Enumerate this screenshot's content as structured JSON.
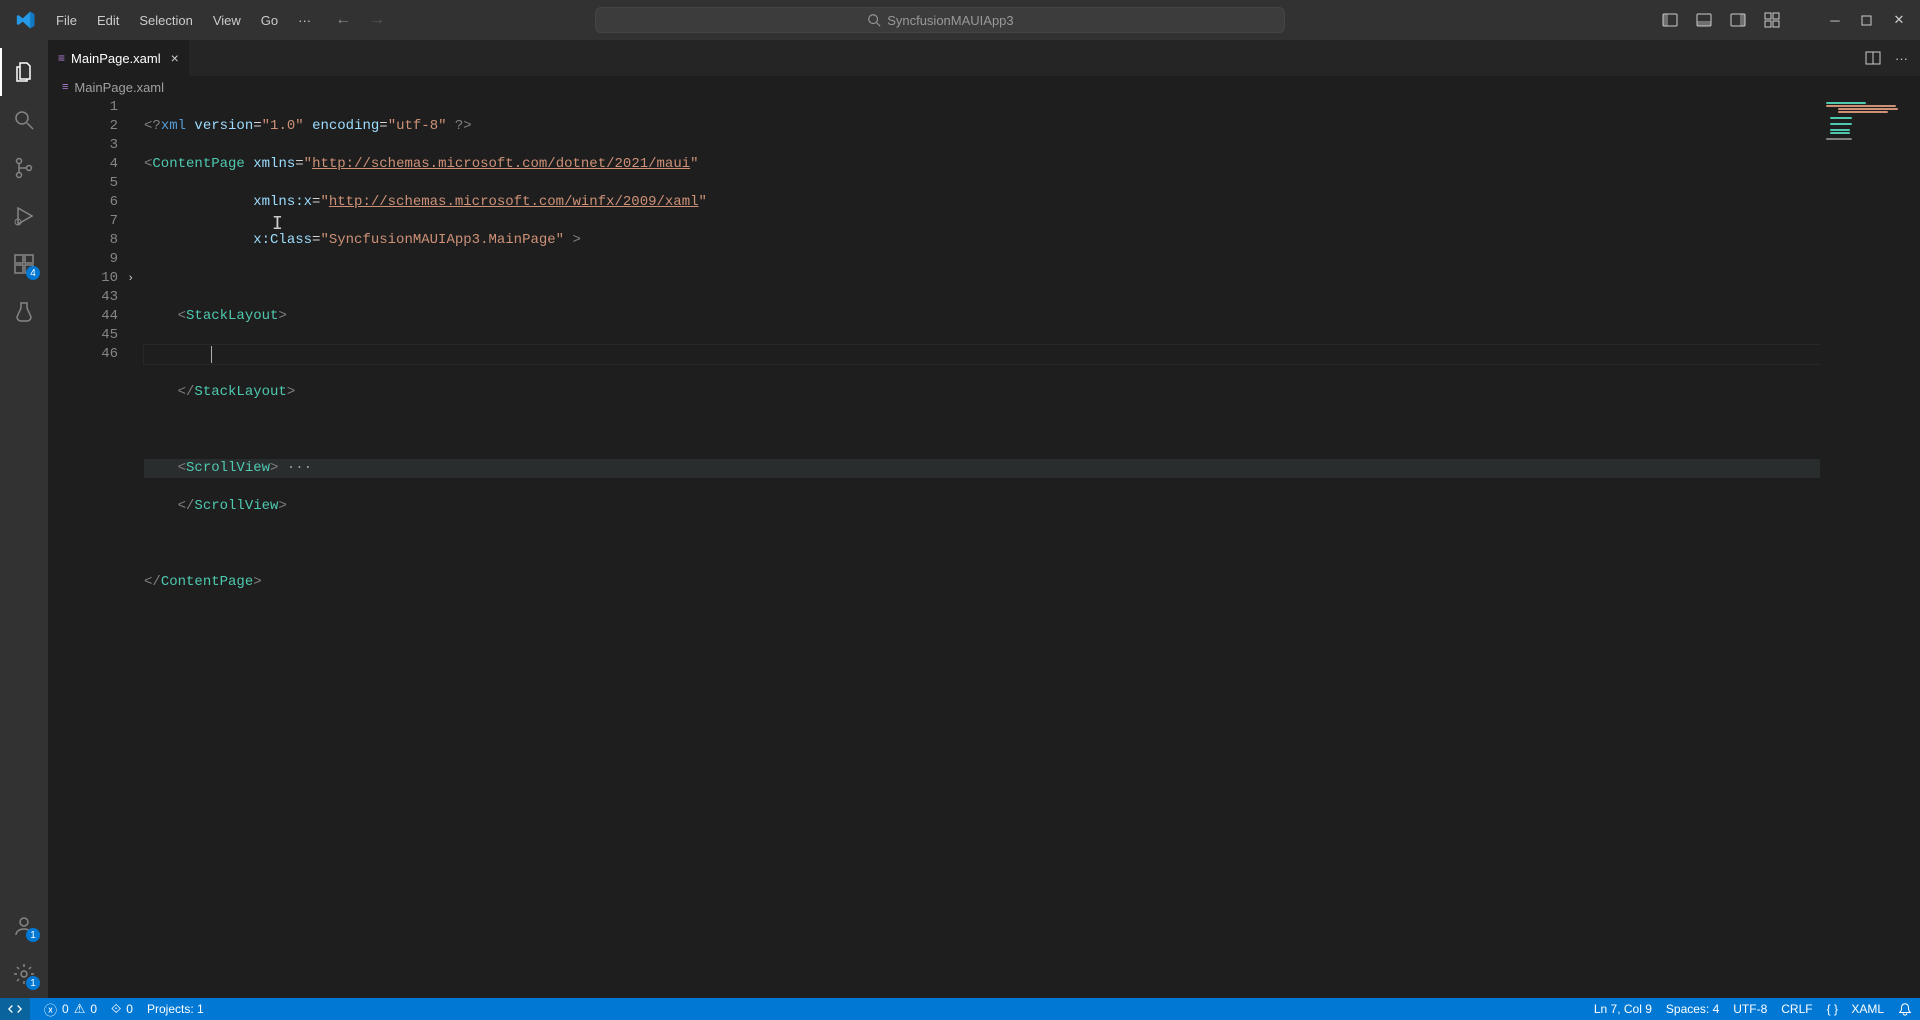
{
  "menu": {
    "file": "File",
    "edit": "Edit",
    "selection": "Selection",
    "view": "View",
    "go": "Go"
  },
  "search": {
    "text": "SyncfusionMAUIApp3"
  },
  "activity": {
    "ext_badge": "4",
    "account_badge": "1",
    "settings_badge": "1"
  },
  "tab": {
    "filename": "MainPage.xaml"
  },
  "breadcrumb": {
    "filename": "MainPage.xaml"
  },
  "lines": {
    "l1": "1",
    "l2": "2",
    "l3": "3",
    "l4": "4",
    "l5": "5",
    "l6": "6",
    "l7": "7",
    "l8": "8",
    "l9": "9",
    "l10": "10",
    "l43": "43",
    "l44": "44",
    "l45": "45",
    "l46": "46"
  },
  "code": {
    "r1_a": "<?",
    "r1_b": "xml ",
    "r1_c": "version",
    "r1_d": "=",
    "r1_e": "\"1.0\"",
    "r1_f": " ",
    "r1_g": "encoding",
    "r1_h": "=",
    "r1_i": "\"utf-8\"",
    "r1_j": " ?>",
    "r2_a": "<",
    "r2_b": "ContentPage ",
    "r2_c": "xmlns",
    "r2_d": "=",
    "r2_e": "\"",
    "r2_f": "http://schemas.microsoft.com/dotnet/2021/maui",
    "r2_g": "\"",
    "r3_a": "xmlns:x",
    "r3_b": "=",
    "r3_c": "\"",
    "r3_d": "http://schemas.microsoft.com/winfx/2009/xaml",
    "r3_e": "\"",
    "r4_a": "x:Class",
    "r4_b": "=",
    "r4_c": "\"SyncfusionMAUIApp3.MainPage\"",
    "r4_d": " >",
    "r6_a": "<",
    "r6_b": "StackLayout",
    "r6_c": ">",
    "r8_a": "</",
    "r8_b": "StackLayout",
    "r8_c": ">",
    "r10_a": "<",
    "r10_b": "ScrollView",
    "r10_c": ">",
    "r10_d": " ···",
    "r43_a": "</",
    "r43_b": "ScrollView",
    "r43_c": ">",
    "r45_a": "</",
    "r45_b": "ContentPage",
    "r45_c": ">"
  },
  "status": {
    "remote": "",
    "errors": "0",
    "warnings": "0",
    "ports": "0",
    "projects": "Projects: 1",
    "ln_col": "Ln 7, Col 9",
    "spaces": "Spaces: 4",
    "encoding": "UTF-8",
    "eol": "CRLF",
    "lang": "XAML"
  }
}
